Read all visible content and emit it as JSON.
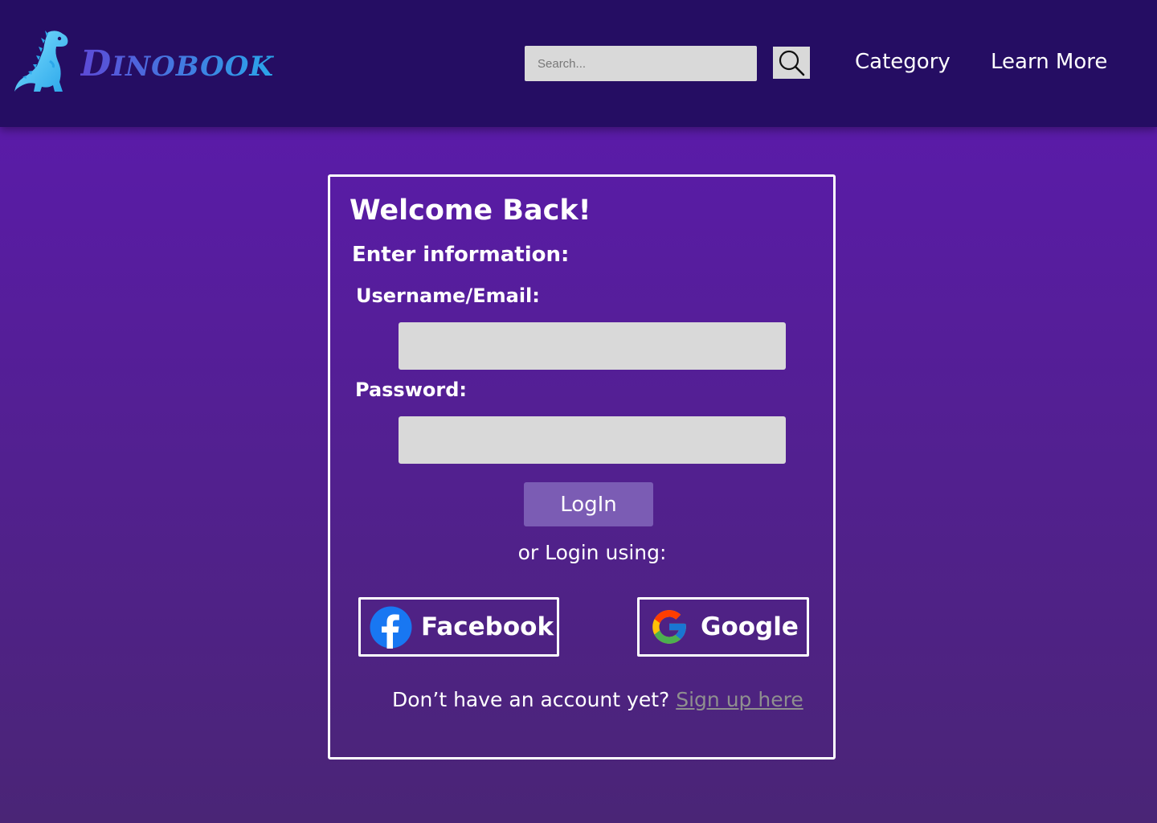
{
  "header": {
    "logo": {
      "text_first": "D",
      "text_rest": "INOBOOK",
      "icon": "dinosaur-icon",
      "colors": [
        "#5d4ad6",
        "#2aa6ea"
      ]
    },
    "search": {
      "placeholder": "Search...",
      "icon": "search-icon"
    },
    "nav": {
      "category": "Category",
      "learn_more": "Learn More"
    }
  },
  "login": {
    "title": "Welcome Back!",
    "subtitle": "Enter information:",
    "username_label": "Username/Email:",
    "password_label": "Password:",
    "login_button": "LogIn",
    "or_text": "or Login using:",
    "facebook_label": "Facebook",
    "google_label": "Google",
    "signup_prompt": "Don’t have an account yet?",
    "signup_link": "Sign up here"
  },
  "colors": {
    "header_bg": "#250d63",
    "page_bg_top": "#5a1ba8",
    "page_bg_bottom": "#4a2576",
    "login_button": "#7b5cb4",
    "input_bg": "#d9d9d9",
    "facebook_blue": "#1877f2"
  }
}
